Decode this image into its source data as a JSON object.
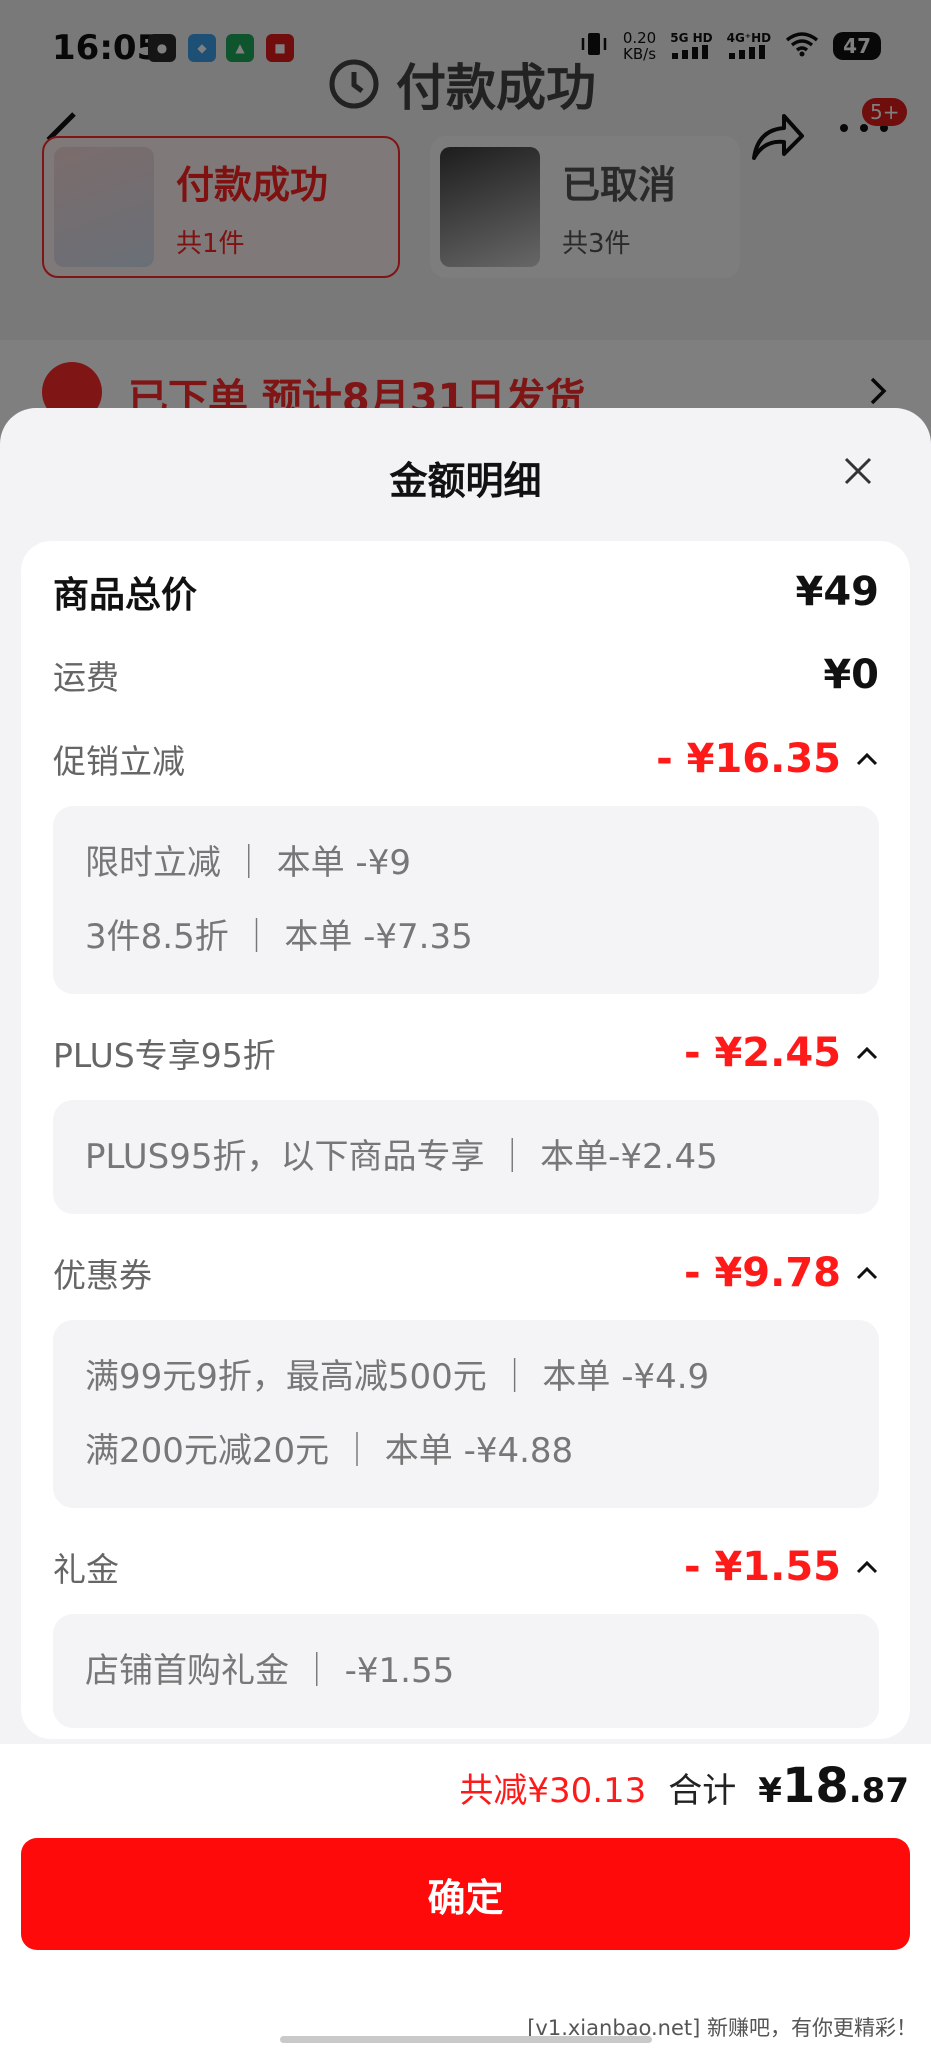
{
  "status_bar": {
    "time": "16:05",
    "net_speed_value": "0.20",
    "net_speed_unit": "KB/s",
    "signal_1": "5G HD",
    "signal_2": "4G⁺HD",
    "battery": "47"
  },
  "background": {
    "title": "付款成功",
    "badge": "5+",
    "orders": [
      {
        "status": "付款成功",
        "count": "共1件"
      },
      {
        "status": "已取消",
        "count": "共3件"
      }
    ],
    "shipping_text": "已下单 预计8月31日发货"
  },
  "sheet": {
    "title": "金额明细",
    "rows": {
      "total_price": {
        "label": "商品总价",
        "value": "¥49"
      },
      "shipping": {
        "label": "运费",
        "value": "¥0"
      },
      "promo": {
        "label": "促销立减",
        "value": "- ¥16.35"
      },
      "plus": {
        "label": "PLUS专享95折",
        "value": "- ¥2.45"
      },
      "coupon": {
        "label": "优惠券",
        "value": "- ¥9.78"
      },
      "gift": {
        "label": "礼金",
        "value": "- ¥1.55"
      }
    },
    "promo_details": [
      "限时立减 ｜ 本单 -¥9",
      "3件8.5折 ｜ 本单 -¥7.35"
    ],
    "plus_details": [
      "PLUS95折，以下商品专享 ｜ 本单-¥2.45"
    ],
    "coupon_details": [
      "满99元9折，最高减500元 ｜ 本单 -¥4.9",
      "满200元减20元 ｜ 本单 -¥4.88"
    ],
    "gift_details": [
      "店铺首购礼金 ｜ -¥1.55"
    ]
  },
  "footer": {
    "total_discount": "共减¥30.13",
    "sum_label": "合计",
    "currency": "¥",
    "amount_int": "18",
    "amount_dec": ".87",
    "confirm_label": "确定",
    "watermark": "[v1.xianbao.net] 新赚吧，有你更精彩！"
  },
  "colors": {
    "accent_red": "#ff1a1a",
    "button_red": "#ff0a0a"
  },
  "icons": [
    "back-icon",
    "share-icon",
    "more-icon",
    "clock-icon",
    "close-icon",
    "chevron-up-icon",
    "chevron-right-icon"
  ]
}
